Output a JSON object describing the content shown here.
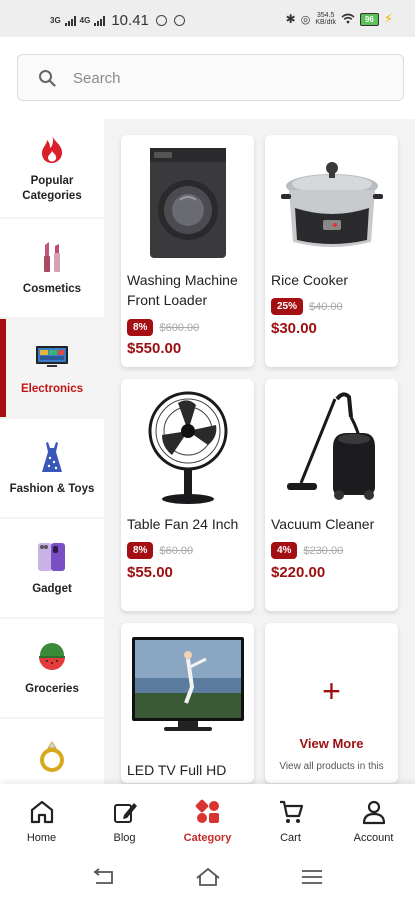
{
  "status_bar": {
    "network_1": "3G",
    "network_2": "4G",
    "time": "10.41",
    "speed_value": "354.5",
    "speed_unit": "KB/dtk",
    "battery": "96"
  },
  "search": {
    "placeholder": "Search"
  },
  "sidebar": {
    "items": [
      {
        "label": "Popular Categories",
        "icon": "fire-icon",
        "active": false
      },
      {
        "label": "Cosmetics",
        "icon": "lipstick-icon",
        "active": false
      },
      {
        "label": "Electronics",
        "icon": "tv-icon",
        "active": true
      },
      {
        "label": "Fashion & Toys",
        "icon": "dress-icon",
        "active": false
      },
      {
        "label": "Gadget",
        "icon": "phone-icon",
        "active": false
      },
      {
        "label": "Groceries",
        "icon": "watermelon-icon",
        "active": false
      },
      {
        "label": "",
        "icon": "ring-icon",
        "active": false
      }
    ]
  },
  "products": [
    {
      "name": "Washing Machine Front Loader",
      "discount": "8%",
      "old_price": "$600.00",
      "price": "$550.00",
      "icon": "washing-machine-image"
    },
    {
      "name": "Rice Cooker",
      "discount": "25%",
      "old_price": "$40.00",
      "price": "$30.00",
      "icon": "rice-cooker-image"
    },
    {
      "name": "Table Fan 24 Inch",
      "discount": "8%",
      "old_price": "$60.00",
      "price": "$55.00",
      "icon": "table-fan-image"
    },
    {
      "name": "Vacuum Cleaner",
      "discount": "4%",
      "old_price": "$230.00",
      "price": "$220.00",
      "icon": "vacuum-cleaner-image"
    },
    {
      "name": "LED TV Full HD",
      "icon": "led-tv-image"
    }
  ],
  "view_more": {
    "label": "View More",
    "sublabel": "View all products in this"
  },
  "bottom_nav": {
    "items": [
      {
        "label": "Home",
        "icon": "home-icon",
        "active": false
      },
      {
        "label": "Blog",
        "icon": "blog-edit-icon",
        "active": false
      },
      {
        "label": "Category",
        "icon": "category-icon",
        "active": true
      },
      {
        "label": "Cart",
        "icon": "cart-icon",
        "active": false
      },
      {
        "label": "Account",
        "icon": "account-icon",
        "active": false
      }
    ]
  },
  "colors": {
    "accent": "#a30f12",
    "price": "#9b0f12",
    "active_nav": "#c62a2a"
  }
}
